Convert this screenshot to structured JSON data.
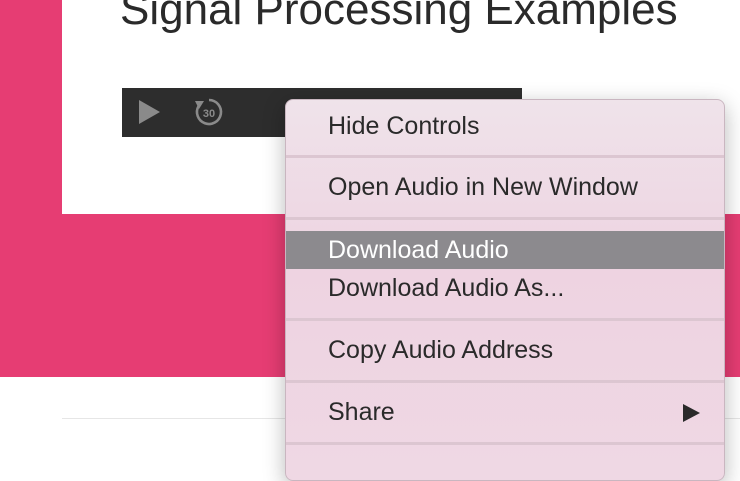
{
  "page": {
    "title": "Signal Processing Examples",
    "colors": {
      "accent": "#e63d73",
      "player_bg": "#2d2d2d",
      "menu_highlight": "#8c8a8e"
    }
  },
  "audio_player": {
    "play_icon": "play-icon",
    "skip_back_icon": "skip-back-30-icon",
    "skip_back_seconds": "30"
  },
  "context_menu": {
    "items": [
      {
        "label": "Hide Controls"
      },
      {
        "label": "Open Audio in New Window"
      },
      {
        "label": "Download Audio",
        "highlighted": true
      },
      {
        "label": "Download Audio As..."
      },
      {
        "label": "Copy Audio Address"
      },
      {
        "label": "Share",
        "submenu": true,
        "submenu_icon": "chevron-right-icon"
      }
    ]
  }
}
